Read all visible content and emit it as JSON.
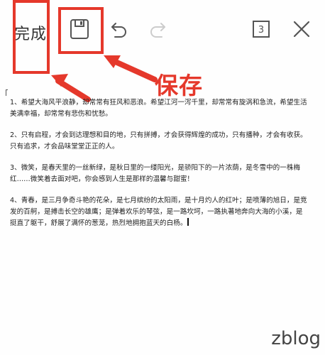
{
  "toolbar": {
    "done_label": "完成",
    "page_count": "3",
    "icons": [
      "save-icon",
      "undo-icon",
      "redo-icon",
      "pages-icon",
      "close-icon"
    ]
  },
  "annotation": {
    "label": "保存",
    "color": "#e5382b"
  },
  "document": {
    "paragraphs": [
      "1、希望大海风平浪静，却常常有狂风和恶浪。希望江河一泻千里，却常常有旋涡和急流，希望生活美满幸福，却常常有悲伤和忧愁。",
      "2、只有启程，才会到达理想和目的地，只有拼搏，才会获得辉煌的成功，只有播种，才会有收获。只有追求，才会品味堂堂正正的人。",
      "3、微笑，是春天里的一丝新绿，是秋日里的一缕阳光，是骄阳下的一片浓荫，是冬雪中的一株梅红……微笑着去面对吧，你会感到人生是那样的温馨与甜蜜！",
      "4、青春，是三月争奇斗艳的花朵，是七月缤纷的太阳雨，是十月灼人的红叶；是喷薄的旭日，是竞发的百舸，是搏击长空的雄鹰；是弹着欢乐的琴弦，是一路坎坷，一路执著地奔向大海的小溪，是挺直了躯干，舒展了满怀的葱茏，热烈地拥抱蓝天的白杨。"
    ]
  },
  "watermark": {
    "text": "zblog"
  }
}
